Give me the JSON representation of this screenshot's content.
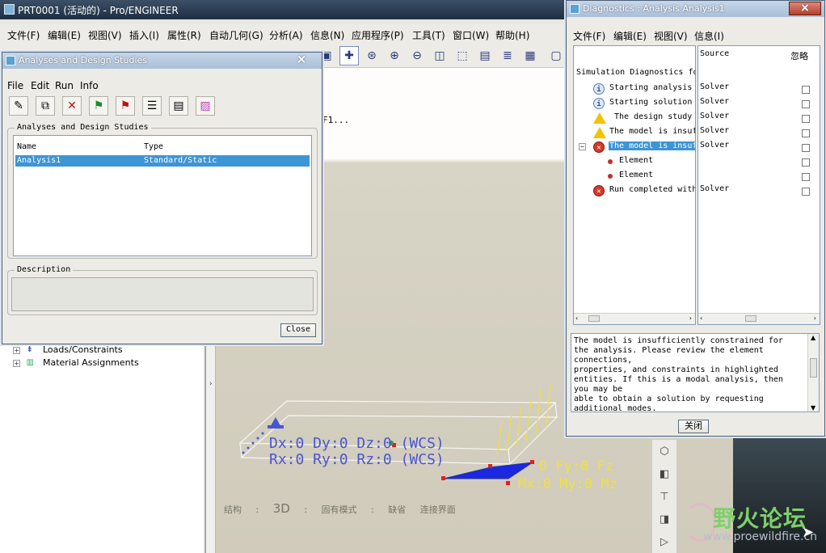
{
  "main": {
    "title": "PRT0001 (活动的) - Pro/ENGINEER",
    "menu": [
      "文件(F)",
      "编辑(E)",
      "视图(V)",
      "插入(I)",
      "属性(R)",
      "自动几何(G)",
      "分析(A)",
      "信息(N)",
      "应用程序(P)",
      "工具(T)",
      "窗口(W)",
      "帮助(H)"
    ],
    "tree": [
      {
        "label": "Loads/Constraints"
      },
      {
        "label": "Material Assignments"
      }
    ],
    "graphics_text_fragment": "F1...",
    "annotations": {
      "line1": "Dx:0 Dy:0 Dz:0 (WCS)",
      "line2": "Rx:0 Ry:0 Rz:0 (WCS)",
      "line3": "0 Fy:0 Fz",
      "line4": "Mx:0 My:0 Mz"
    },
    "status": [
      "结构",
      ":",
      "3D",
      ":",
      "固有模式",
      ":",
      "缺省",
      "连接界面"
    ],
    "watermark": {
      "title": "野火论坛",
      "url": "www.proewildfire.cn"
    }
  },
  "analyses_dialog": {
    "title": "Analyses and Design Studies",
    "close_glyph": "×",
    "menu": [
      "File",
      "Edit",
      "Run",
      "Info"
    ],
    "group_label": "Analyses and Design Studies",
    "columns": [
      "Name",
      "Type"
    ],
    "rows": [
      {
        "name": "Analysis1",
        "type": "Standard/Static"
      }
    ],
    "description_label": "Description",
    "close_button": "Close"
  },
  "diagnostics_dialog": {
    "title": "Diagnostics : Analysis Analysis1",
    "close_glyph": "×",
    "menu": [
      "文件(F)",
      "编辑(E)",
      "视图(V)",
      "信息(I)"
    ],
    "columns": {
      "source": "Source",
      "ignore": "忽略"
    },
    "root": "Simulation Diagnostics fo",
    "items": [
      {
        "icon": "info",
        "text": "Starting analysis",
        "source": "Solver"
      },
      {
        "icon": "info",
        "text": "Starting solution",
        "source": "Solver"
      },
      {
        "icon": "warning",
        "text": "The design study",
        "source": "Solver"
      },
      {
        "icon": "warning",
        "text": "The model is insuf",
        "source": "Solver"
      },
      {
        "icon": "error",
        "text": "The model is insuf",
        "source": "Solver",
        "selected": true
      },
      {
        "icon": "dot",
        "text": "Element",
        "source": ""
      },
      {
        "icon": "dot",
        "text": "Element",
        "source": ""
      },
      {
        "icon": "error",
        "text": "Run completed with",
        "source": "Solver"
      }
    ],
    "message_lines": [
      "The model is insufficiently constrained for",
      "the analysis. Please review the element",
      "connections,",
      "properties, and constraints in highlighted",
      "entities. If this is a modal analysis, then",
      "you may be",
      "able to obtain a solution by requesting",
      "additional modes."
    ],
    "close_button": "关闭"
  },
  "colors": {
    "selection": "#3d95d6",
    "annotation_blue": "#4a56d0",
    "load_yellow": "#f0e040"
  }
}
